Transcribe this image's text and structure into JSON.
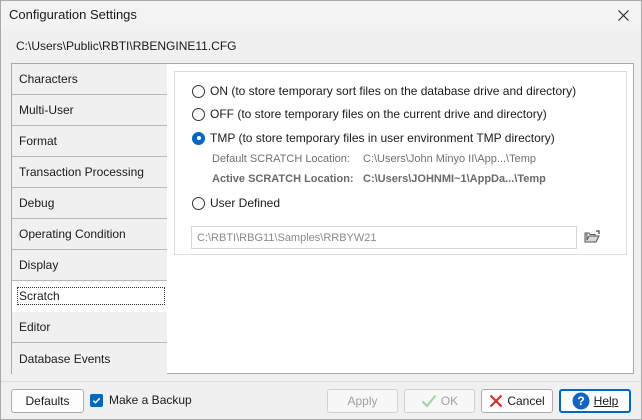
{
  "window": {
    "title": "Configuration Settings"
  },
  "config_path": "C:\\Users\\Public\\RBTI\\RBENGINE11.CFG",
  "sidebar": {
    "items": [
      {
        "label": "Characters"
      },
      {
        "label": "Multi-User"
      },
      {
        "label": "Format"
      },
      {
        "label": "Transaction Processing"
      },
      {
        "label": "Debug"
      },
      {
        "label": "Operating Condition"
      },
      {
        "label": "Display"
      },
      {
        "label": "Scratch"
      },
      {
        "label": "Editor"
      },
      {
        "label": "Database Events"
      }
    ],
    "selected": "Scratch"
  },
  "scratch": {
    "options": [
      {
        "label": "ON (to store temporary sort files on the database drive and directory)",
        "checked": false
      },
      {
        "label": "OFF (to store temporary files on the current drive and directory)",
        "checked": false
      },
      {
        "label": "TMP (to store temporary files in user environment TMP directory)",
        "checked": true
      },
      {
        "label": "User Defined",
        "checked": false
      }
    ],
    "default_location_label": "Default SCRATCH Location:",
    "default_location_value": "C:\\Users\\John Minyo II\\App...\\Temp",
    "active_location_label": "Active SCRATCH Location:",
    "active_location_value": "C:\\Users\\JOHNMI~1\\AppDa...\\Temp",
    "user_defined_path": "C:\\RBTI\\RBG11\\Samples\\RRBYW21"
  },
  "footer": {
    "defaults_label": "Defaults",
    "make_backup_label": "Make a Backup",
    "make_backup_checked": true,
    "apply_label": "Apply",
    "ok_label": "OK",
    "cancel_label": "Cancel",
    "help_label": "Help"
  },
  "colors": {
    "accent": "#0067c0",
    "ok_check": "#9bd4a0",
    "cancel_x": "#d32f2f"
  }
}
